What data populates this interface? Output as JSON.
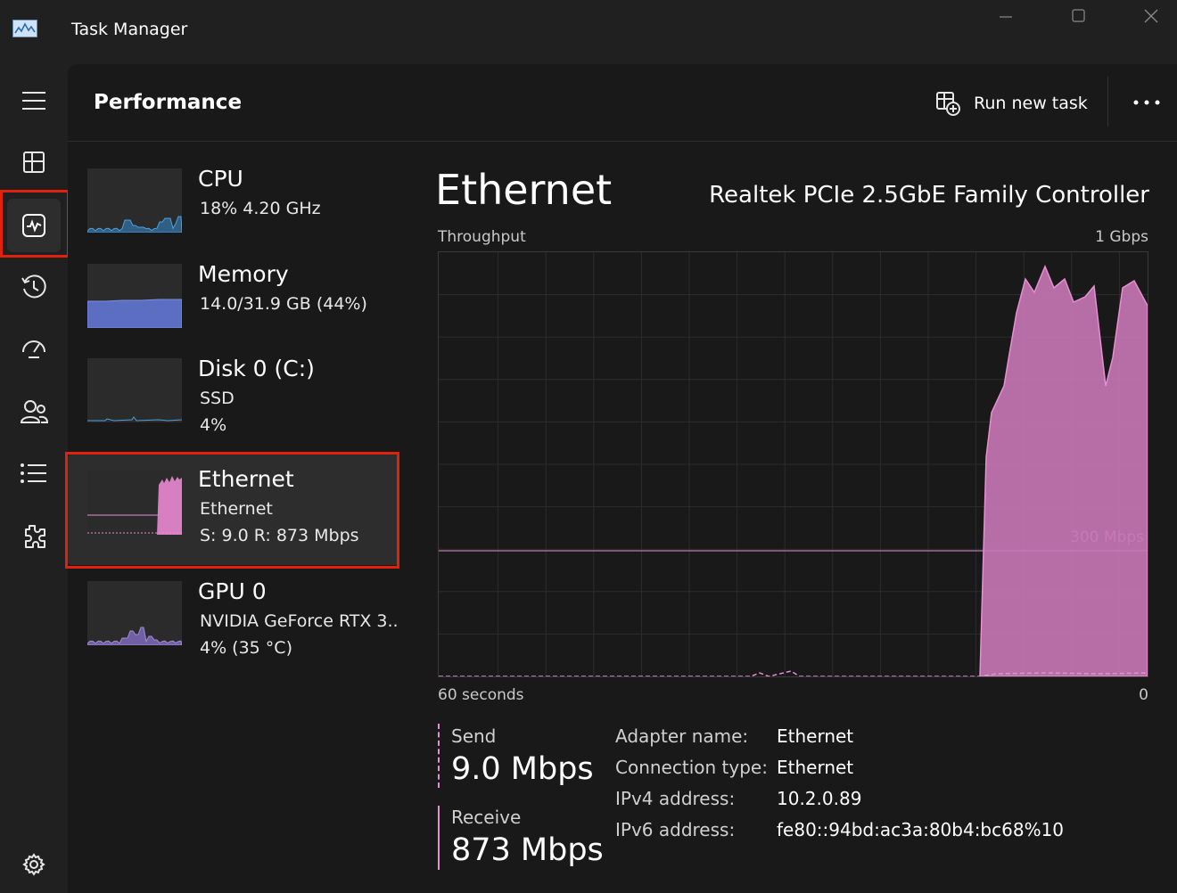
{
  "window": {
    "title": "Task Manager"
  },
  "header": {
    "title": "Performance",
    "run_new_task": "Run new task"
  },
  "nav": {
    "items": [
      {
        "name": "hamburger-menu-icon"
      },
      {
        "name": "processes-icon"
      },
      {
        "name": "performance-icon",
        "active": true
      },
      {
        "name": "app-history-icon"
      },
      {
        "name": "startup-apps-icon"
      },
      {
        "name": "users-icon"
      },
      {
        "name": "details-icon"
      },
      {
        "name": "services-icon"
      },
      {
        "name": "settings-icon"
      }
    ]
  },
  "devices": [
    {
      "name": "CPU",
      "line1": "18%  4.20 GHz",
      "line2": "",
      "usage": 0.18
    },
    {
      "name": "Memory",
      "line1": "14.0/31.9 GB (44%)",
      "line2": "",
      "usage": 0.44
    },
    {
      "name": "Disk 0 (C:)",
      "line1": "SSD",
      "line2": "4%",
      "usage": 0.04
    },
    {
      "name": "Ethernet",
      "line1": "Ethernet",
      "line2": "S: 9.0  R: 873 Mbps",
      "selected": true
    },
    {
      "name": "GPU 0",
      "line1": "NVIDIA GeForce RTX 3..",
      "line2": "4%  (35 °C)",
      "usage": 0.04
    }
  ],
  "colors": {
    "cpu": "#4aa3df",
    "memory": "#6f7fd6",
    "disk": "#4aa3df",
    "ethernet": "#e58fd1",
    "gpu": "#a48bd6",
    "highlight": "#e0210b"
  },
  "detail": {
    "title": "Ethernet",
    "model": "Realtek PCIe 2.5GbE Family Controller",
    "graph_label": "Throughput",
    "graph_max": "1 Gbps",
    "graph_mark": "300 Mbps",
    "time_left": "60 seconds",
    "time_right": "0",
    "send_label": "Send",
    "send_value": "9.0 Mbps",
    "receive_label": "Receive",
    "receive_value": "873 Mbps",
    "properties": [
      {
        "key": "Adapter name:",
        "value": "Ethernet"
      },
      {
        "key": "Connection type:",
        "value": "Ethernet"
      },
      {
        "key": "IPv4 address:",
        "value": "10.2.0.89"
      },
      {
        "key": "IPv6 address:",
        "value": "fe80::94bd:ac3a:80b4:bc68%10"
      }
    ]
  }
}
